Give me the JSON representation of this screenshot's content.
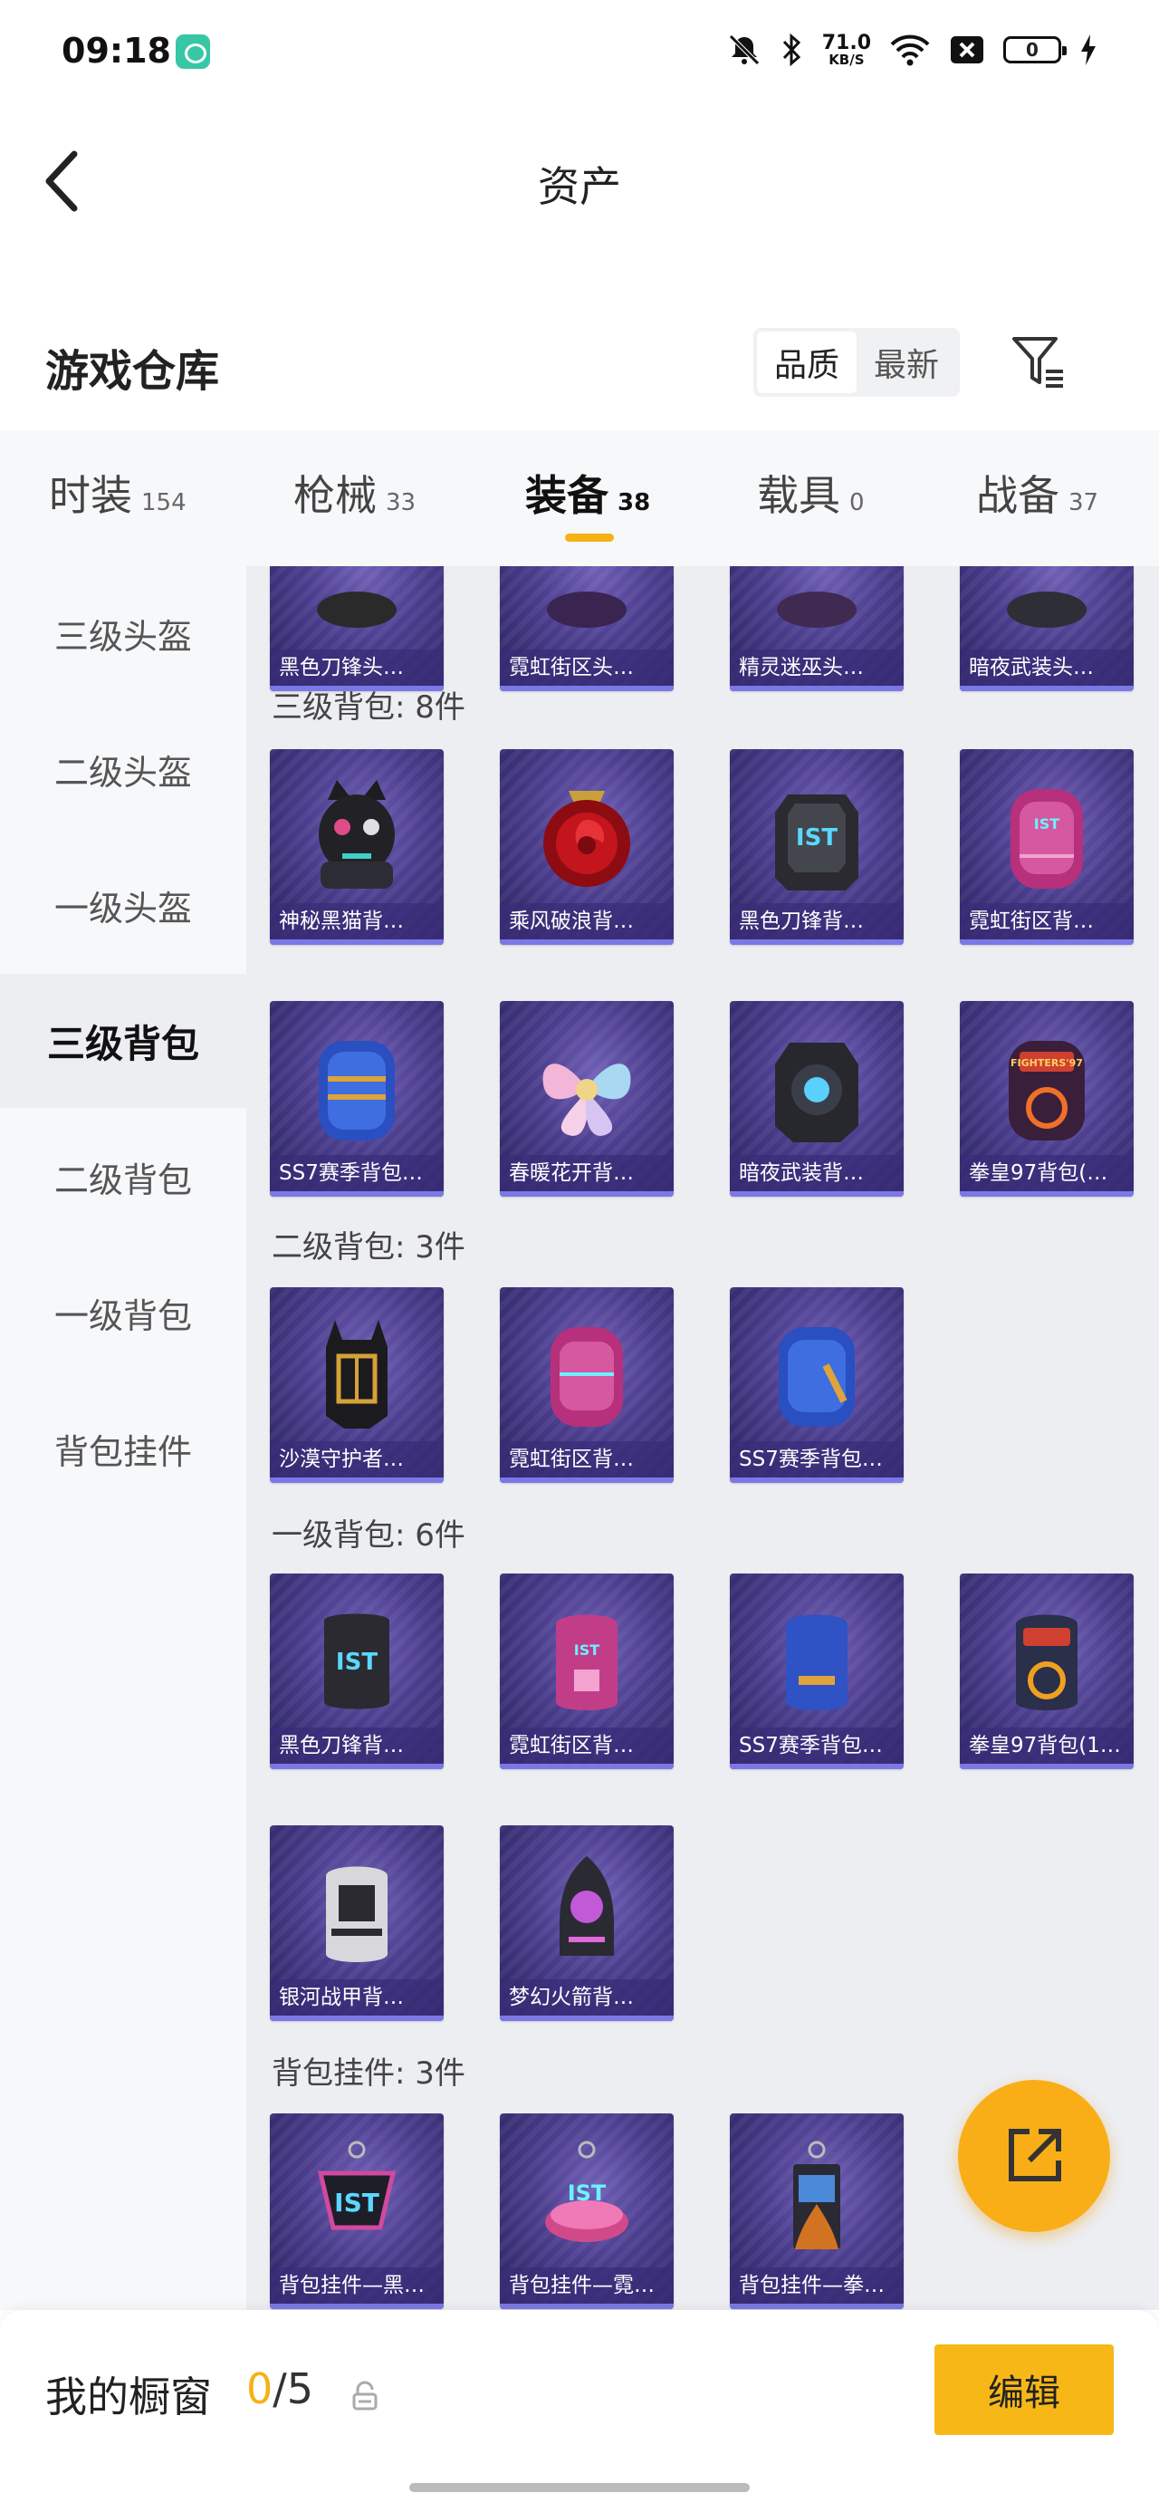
{
  "status_bar": {
    "time": "09:18",
    "net_speed_value": "71.0",
    "net_speed_unit": "KB/S",
    "battery_level": "0"
  },
  "header": {
    "title": "资产"
  },
  "warehouse": {
    "title": "游戏仓库",
    "sort_quality": "品质",
    "sort_newest": "最新"
  },
  "category_tabs": [
    {
      "label": "时装",
      "count": "154"
    },
    {
      "label": "枪械",
      "count": "33"
    },
    {
      "label": "装备",
      "count": "38"
    },
    {
      "label": "载具",
      "count": "0"
    },
    {
      "label": "战备",
      "count": "37"
    }
  ],
  "active_tab": "装备",
  "sidebar": {
    "items": [
      {
        "label": "三级头盔"
      },
      {
        "label": "二级头盔"
      },
      {
        "label": "一级头盔"
      },
      {
        "label": "三级背包"
      },
      {
        "label": "二级背包"
      },
      {
        "label": "一级背包"
      },
      {
        "label": "背包挂件"
      }
    ],
    "active": "三级背包"
  },
  "sections": {
    "helmet_partial": [
      {
        "name": "黑色刀锋头…"
      },
      {
        "name": "霓虹街区头…"
      },
      {
        "name": "精灵迷巫头…"
      },
      {
        "name": "暗夜武装头…"
      }
    ],
    "lvl3_backpack": {
      "title": "三级背包: 8件",
      "items": [
        {
          "name": "神秘黑猫背…"
        },
        {
          "name": "乘风破浪背…"
        },
        {
          "name": "黑色刀锋背…"
        },
        {
          "name": "霓虹街区背…"
        },
        {
          "name": "SS7赛季背包…"
        },
        {
          "name": "春暖花开背…"
        },
        {
          "name": "暗夜武装背…"
        },
        {
          "name": "拳皇97背包(…"
        }
      ]
    },
    "lvl2_backpack": {
      "title": "二级背包: 3件",
      "items": [
        {
          "name": "沙漠守护者…"
        },
        {
          "name": "霓虹街区背…"
        },
        {
          "name": "SS7赛季背包…"
        }
      ]
    },
    "lvl1_backpack": {
      "title": "一级背包: 6件",
      "items": [
        {
          "name": "黑色刀锋背…"
        },
        {
          "name": "霓虹街区背…"
        },
        {
          "name": "SS7赛季背包…"
        },
        {
          "name": "拳皇97背包(1…"
        },
        {
          "name": "银河战甲背…"
        },
        {
          "name": "梦幻火箭背…"
        }
      ]
    },
    "pendant": {
      "title": "背包挂件: 3件",
      "items": [
        {
          "name": "背包挂件—黑…"
        },
        {
          "name": "背包挂件—霓…"
        },
        {
          "name": "背包挂件—拳…"
        }
      ]
    }
  },
  "showcase": {
    "label": "我的橱窗",
    "current": "0",
    "separator": "/",
    "max": "5",
    "edit_label": "编辑"
  },
  "colors": {
    "accent": "#f5b116",
    "card_bg": "#3e3380",
    "card_bar": "#7b78e6",
    "content_bg": "#eceef2",
    "sidebar_bg": "#f7f8fa"
  }
}
